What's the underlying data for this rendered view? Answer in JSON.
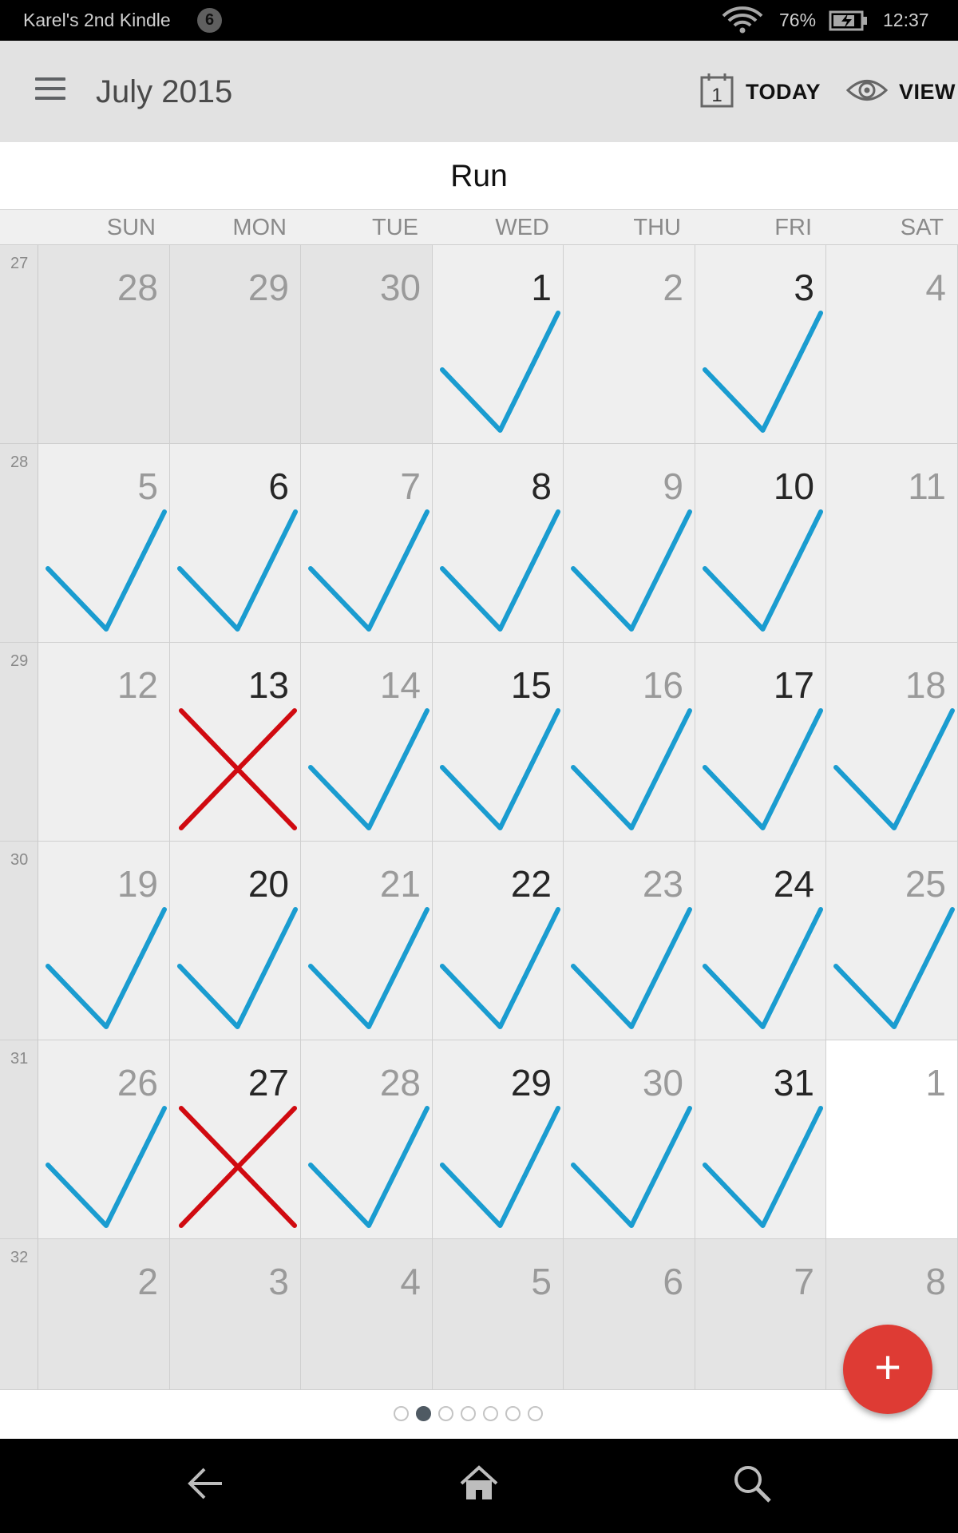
{
  "status_bar": {
    "device_name": "Karel's 2nd Kindle",
    "notification_count": "6",
    "battery_percent": "76%",
    "time": "12:37",
    "icons": [
      "wifi-icon",
      "battery-charging-icon"
    ]
  },
  "toolbar": {
    "title": "July 2015",
    "today_label": "TODAY",
    "today_icon_day": "1",
    "view_label": "VIEW",
    "icons": [
      "menu-icon",
      "calendar-today-icon",
      "eye-icon"
    ]
  },
  "habit": {
    "name": "Run"
  },
  "calendar": {
    "weekdays": [
      "SUN",
      "MON",
      "TUE",
      "WED",
      "THU",
      "FRI",
      "SAT"
    ],
    "weeks": [
      {
        "week_number": "27",
        "days": [
          {
            "date": "28",
            "month": "prev",
            "status": "none",
            "bold": false
          },
          {
            "date": "29",
            "month": "prev",
            "status": "none",
            "bold": false
          },
          {
            "date": "30",
            "month": "prev",
            "status": "none",
            "bold": false
          },
          {
            "date": "1",
            "month": "current",
            "status": "done",
            "bold": true
          },
          {
            "date": "2",
            "month": "current",
            "status": "none",
            "bold": false
          },
          {
            "date": "3",
            "month": "current",
            "status": "done",
            "bold": true
          },
          {
            "date": "4",
            "month": "current",
            "status": "none",
            "bold": false
          }
        ]
      },
      {
        "week_number": "28",
        "days": [
          {
            "date": "5",
            "month": "current",
            "status": "done",
            "bold": false
          },
          {
            "date": "6",
            "month": "current",
            "status": "done",
            "bold": true
          },
          {
            "date": "7",
            "month": "current",
            "status": "done",
            "bold": false
          },
          {
            "date": "8",
            "month": "current",
            "status": "done",
            "bold": true
          },
          {
            "date": "9",
            "month": "current",
            "status": "done",
            "bold": false
          },
          {
            "date": "10",
            "month": "current",
            "status": "done",
            "bold": true
          },
          {
            "date": "11",
            "month": "current",
            "status": "none",
            "bold": false
          }
        ]
      },
      {
        "week_number": "29",
        "days": [
          {
            "date": "12",
            "month": "current",
            "status": "none",
            "bold": false
          },
          {
            "date": "13",
            "month": "current",
            "status": "missed",
            "bold": true
          },
          {
            "date": "14",
            "month": "current",
            "status": "done",
            "bold": false
          },
          {
            "date": "15",
            "month": "current",
            "status": "done",
            "bold": true
          },
          {
            "date": "16",
            "month": "current",
            "status": "done",
            "bold": false
          },
          {
            "date": "17",
            "month": "current",
            "status": "done",
            "bold": true
          },
          {
            "date": "18",
            "month": "current",
            "status": "done",
            "bold": false
          }
        ]
      },
      {
        "week_number": "30",
        "days": [
          {
            "date": "19",
            "month": "current",
            "status": "done",
            "bold": false
          },
          {
            "date": "20",
            "month": "current",
            "status": "done",
            "bold": true
          },
          {
            "date": "21",
            "month": "current",
            "status": "done",
            "bold": false
          },
          {
            "date": "22",
            "month": "current",
            "status": "done",
            "bold": true
          },
          {
            "date": "23",
            "month": "current",
            "status": "done",
            "bold": false
          },
          {
            "date": "24",
            "month": "current",
            "status": "done",
            "bold": true
          },
          {
            "date": "25",
            "month": "current",
            "status": "done",
            "bold": false
          }
        ]
      },
      {
        "week_number": "31",
        "days": [
          {
            "date": "26",
            "month": "current",
            "status": "done",
            "bold": false
          },
          {
            "date": "27",
            "month": "current",
            "status": "missed",
            "bold": true
          },
          {
            "date": "28",
            "month": "current",
            "status": "done",
            "bold": false
          },
          {
            "date": "29",
            "month": "current",
            "status": "done",
            "bold": true
          },
          {
            "date": "30",
            "month": "current",
            "status": "done",
            "bold": false
          },
          {
            "date": "31",
            "month": "current",
            "status": "done",
            "bold": true
          },
          {
            "date": "1",
            "month": "next",
            "status": "none",
            "bold": false,
            "today": true
          }
        ]
      },
      {
        "week_number": "32",
        "days": [
          {
            "date": "2",
            "month": "next",
            "status": "none",
            "bold": false
          },
          {
            "date": "3",
            "month": "next",
            "status": "none",
            "bold": false
          },
          {
            "date": "4",
            "month": "next",
            "status": "none",
            "bold": false
          },
          {
            "date": "5",
            "month": "next",
            "status": "none",
            "bold": false
          },
          {
            "date": "6",
            "month": "next",
            "status": "none",
            "bold": false
          },
          {
            "date": "7",
            "month": "next",
            "status": "none",
            "bold": false
          },
          {
            "date": "8",
            "month": "next",
            "status": "none",
            "bold": false
          }
        ]
      }
    ]
  },
  "pager": {
    "page_count": 7,
    "active_index": 1
  },
  "fab": {
    "label": "+",
    "icon": "add-icon"
  },
  "nav_bar": {
    "icons": [
      "back-icon",
      "home-icon",
      "search-icon"
    ]
  },
  "colors": {
    "check": "#1a9cd0",
    "cross": "#d00a10",
    "fab": "#de3b34",
    "toolbar": "#e2e2e2"
  }
}
